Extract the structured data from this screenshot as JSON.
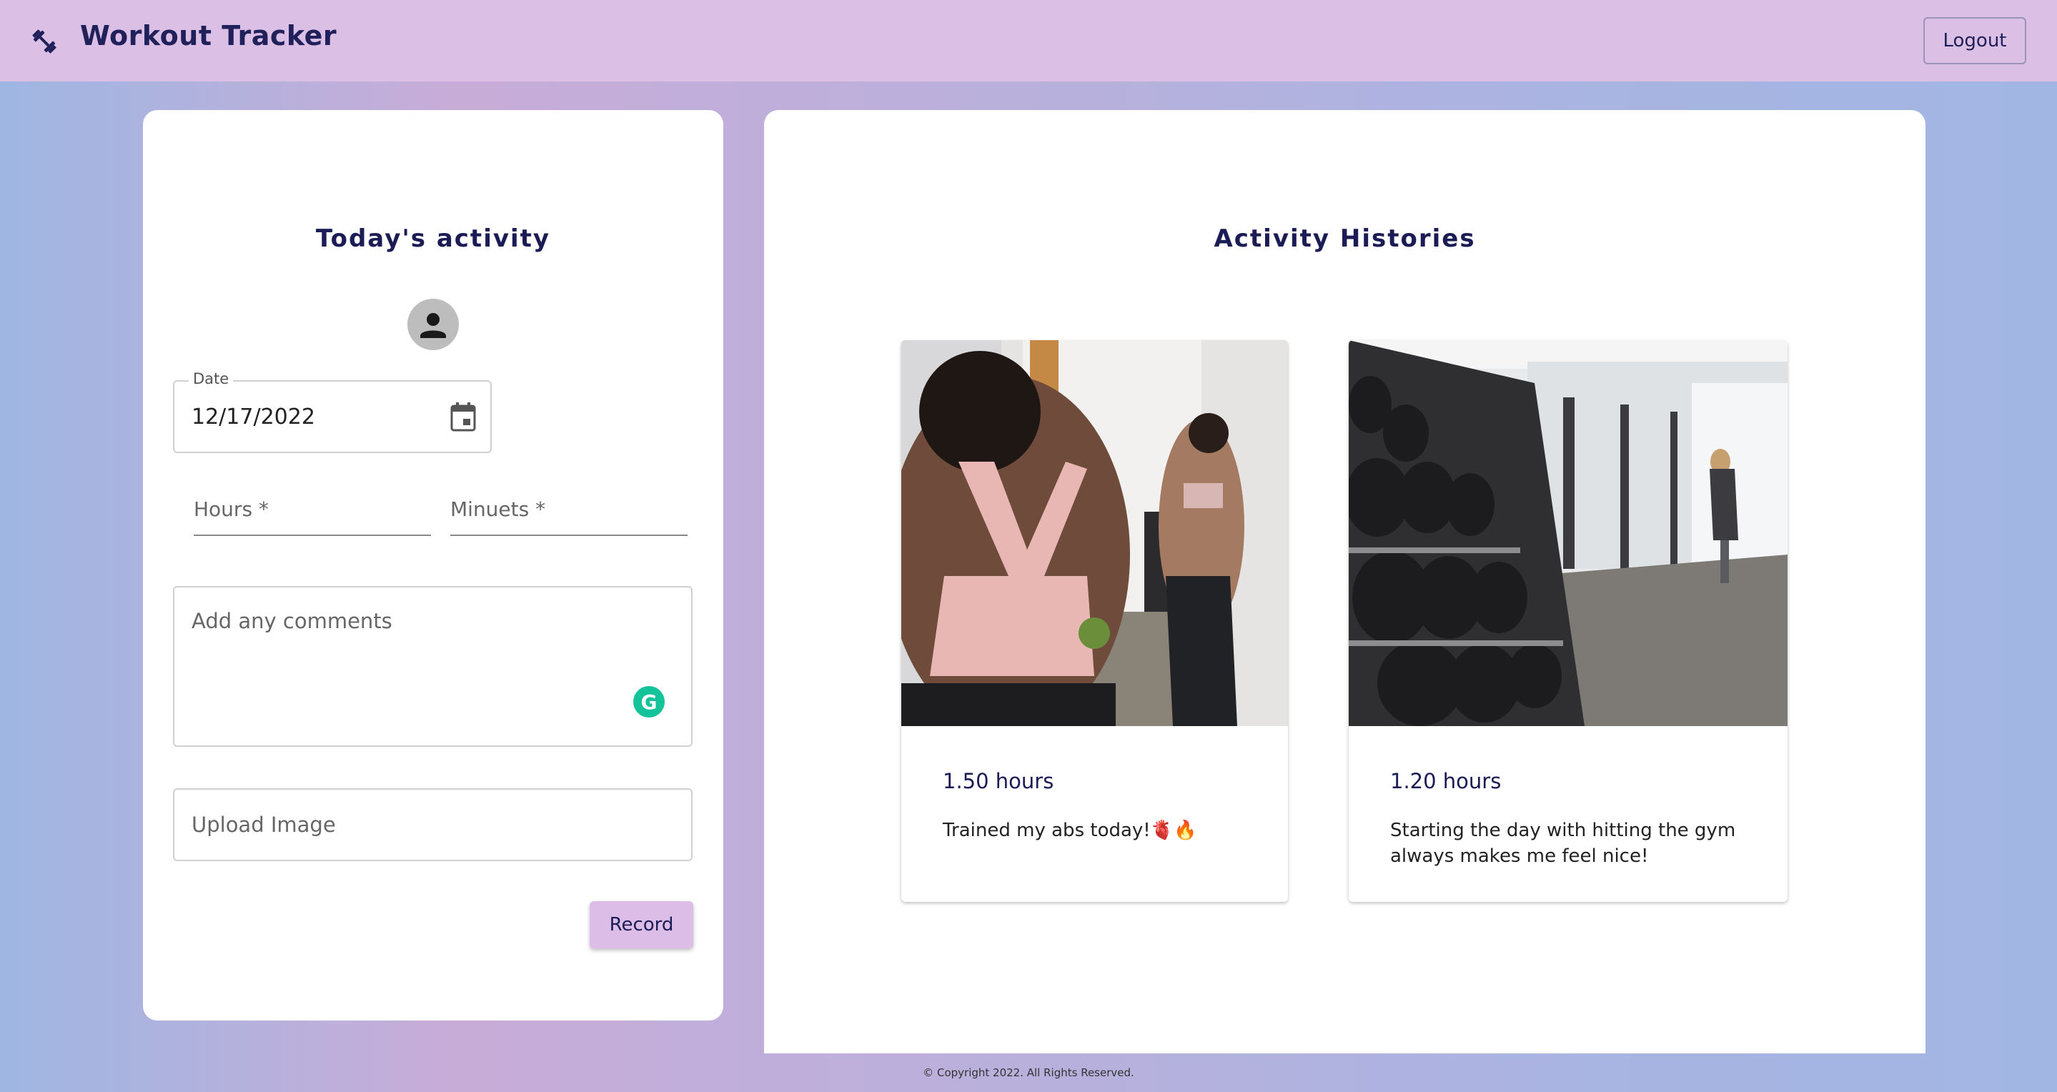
{
  "header": {
    "title": "Workout Tracker",
    "logout_label": "Logout",
    "logo_icon": "fitness-center-icon"
  },
  "form": {
    "title": "Today's activity",
    "avatar_icon": "person-icon",
    "date_label": "Date",
    "date_value": "12/17/2022",
    "hours_placeholder": "Hours *",
    "minutes_placeholder": "Minuets *",
    "comments_placeholder": "Add any comments",
    "upload_placeholder": "Upload Image",
    "record_label": "Record"
  },
  "history": {
    "title": "Activity Histories",
    "items": [
      {
        "hours": "1.50 hours",
        "comment": "Trained my abs today!🫀🔥"
      },
      {
        "hours": "1.20 hours",
        "comment": "Starting the day with hitting the gym always makes me feel nice!"
      }
    ]
  },
  "footer": {
    "copyright": "© Copyright 2022. All Rights Reserved."
  },
  "colors": {
    "header_bg": "#dbbfe5",
    "accent_button": "#dcbde8",
    "title_text": "#1b1b55"
  }
}
